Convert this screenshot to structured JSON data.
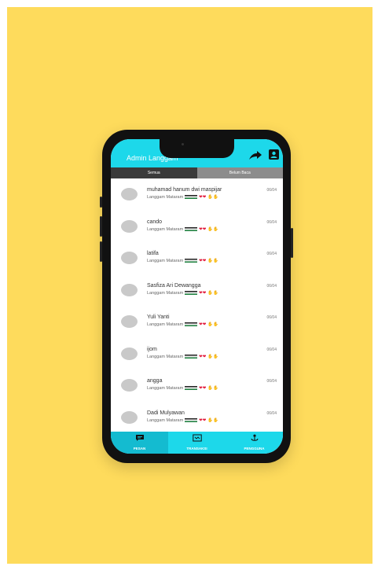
{
  "app": {
    "title": "Admin Langgam"
  },
  "tabs": [
    "Semua",
    "Belum Baca"
  ],
  "chats": [
    {
      "name": "muhamad hanum dwi maspijar",
      "preview": "Langgam Mataram",
      "date": "06/04"
    },
    {
      "name": "cando",
      "preview": "Langgam Mataram",
      "date": "06/04"
    },
    {
      "name": "latifa",
      "preview": "Langgam Mataram",
      "date": "06/04"
    },
    {
      "name": "Sasfiza Ari Dewangga",
      "preview": "Langgam Mataram",
      "date": "06/04"
    },
    {
      "name": "Yuli Yanti",
      "preview": "Langgam Mataram",
      "date": "06/04"
    },
    {
      "name": "ijom",
      "preview": "Langgam Mataram",
      "date": "06/04"
    },
    {
      "name": "angga",
      "preview": "Langgam Mataram",
      "date": "06/04"
    },
    {
      "name": "Dadi Mulyawan",
      "preview": "Langgam Mataram",
      "date": "06/04"
    }
  ],
  "bottom_nav": [
    "PESAN",
    "TRANSAKSI",
    "PENGGUNA"
  ],
  "icons": {
    "share": "share-arrow-icon",
    "account": "account-box-icon",
    "pesan": "message-icon",
    "transaksi": "transaction-icon",
    "pengguna": "users-icon"
  },
  "colors": {
    "background": "#FEDB5C",
    "accent": "#1DD8EA",
    "tab_active": "#3a3a3a",
    "tab_inactive": "#8c8c8c"
  }
}
